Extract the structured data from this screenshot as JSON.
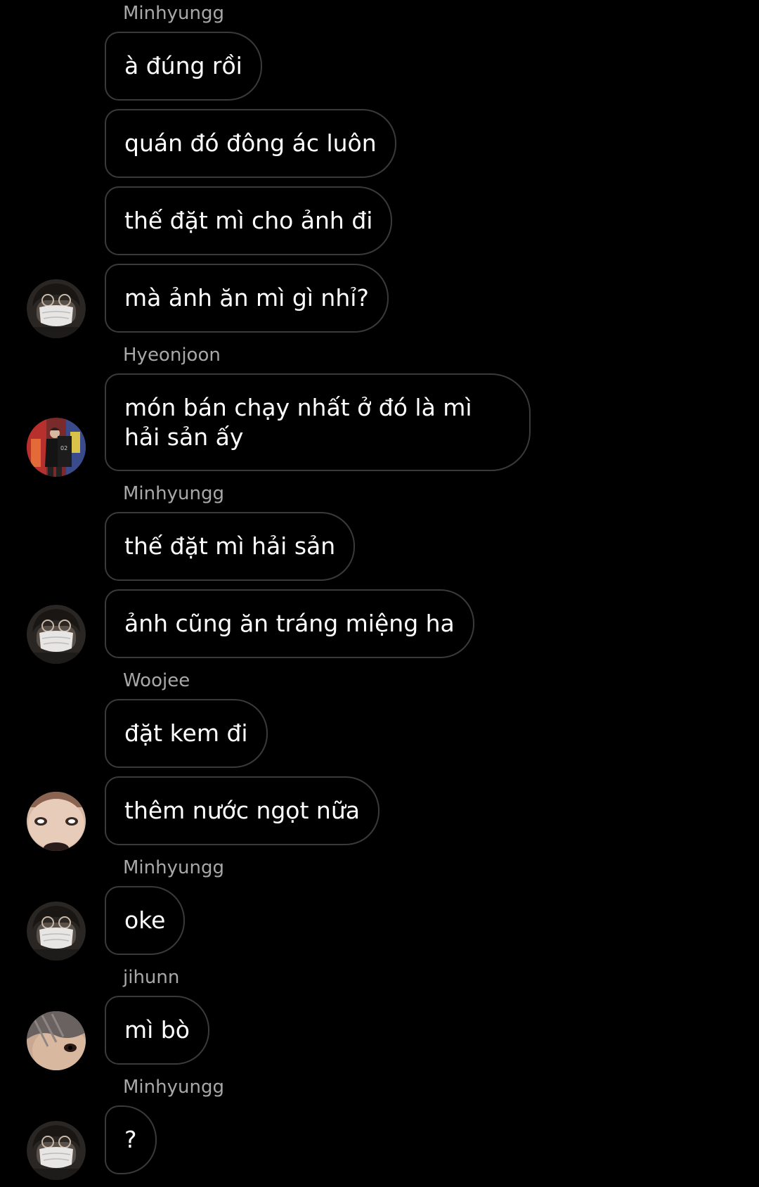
{
  "chat": {
    "colors": {
      "background": "#000000",
      "bubble_border": "#3a3a3a",
      "sender_name": "#a8a8a8",
      "message_text": "#ffffff"
    },
    "messages": [
      {
        "sender": "Minhyungg",
        "text": "à đúng rồi"
      },
      {
        "text": "quán đó đông ác luôn"
      },
      {
        "text": "thế đặt mì cho ảnh đi"
      },
      {
        "text": "mà ảnh ăn mì gì nhỉ?",
        "avatar": "minhyungg-avatar"
      },
      {
        "sender": "Hyeonjoon",
        "text": "món bán chạy nhất ở đó là mì hải sản ấy",
        "avatar": "hyeonjoon-avatar"
      },
      {
        "sender": "Minhyungg",
        "text": "thế đặt mì hải sản"
      },
      {
        "text": "ảnh cũng ăn tráng miệng ha",
        "avatar": "minhyungg-avatar"
      },
      {
        "sender": "Woojee",
        "text": "đặt kem đi"
      },
      {
        "text": "thêm nước ngọt nữa",
        "avatar": "woojee-avatar"
      },
      {
        "sender": "Minhyungg",
        "text": "oke",
        "avatar": "minhyungg-avatar"
      },
      {
        "sender": "jihunn",
        "text": "mì bò",
        "avatar": "jihunn-avatar"
      },
      {
        "sender": "Minhyungg",
        "text": "?",
        "avatar": "minhyungg-avatar"
      }
    ]
  }
}
